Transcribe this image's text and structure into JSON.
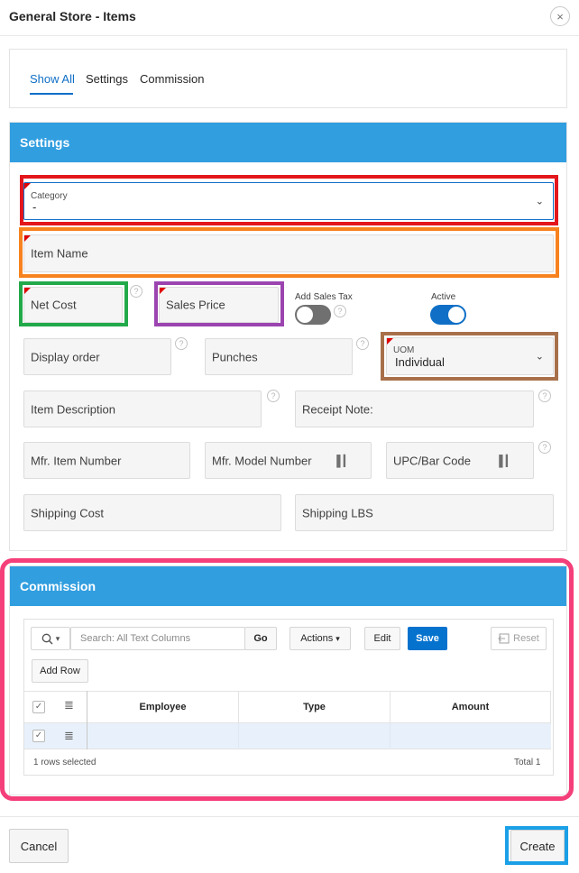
{
  "dialog": {
    "title": "General Store - Items",
    "close_icon": "×"
  },
  "tabs": [
    {
      "label": "Show All",
      "active": true
    },
    {
      "label": "Settings",
      "active": false
    },
    {
      "label": "Commission",
      "active": false
    }
  ],
  "settings": {
    "header": "Settings",
    "category": {
      "label": "Category",
      "value": "-"
    },
    "item_name": {
      "placeholder": "Item Name"
    },
    "net_cost": {
      "placeholder": "Net Cost"
    },
    "sales_price": {
      "placeholder": "Sales Price"
    },
    "add_sales_tax": {
      "label": "Add Sales Tax",
      "on": false
    },
    "active": {
      "label": "Active",
      "on": true
    },
    "display_order": {
      "placeholder": "Display order"
    },
    "punches": {
      "placeholder": "Punches"
    },
    "uom": {
      "label": "UOM",
      "value": "Individual"
    },
    "item_description": {
      "placeholder": "Item Description"
    },
    "receipt_note": {
      "placeholder": "Receipt Note:"
    },
    "mfr_item_number": {
      "placeholder": "Mfr. Item Number"
    },
    "mfr_model_number": {
      "placeholder": "Mfr. Model Number"
    },
    "upc_bar_code": {
      "placeholder": "UPC/Bar Code"
    },
    "shipping_cost": {
      "placeholder": "Shipping Cost"
    },
    "shipping_lbs": {
      "placeholder": "Shipping LBS"
    },
    "help_glyph": "?",
    "chevron_glyph": "⌄",
    "barcode_glyph": "▌▎"
  },
  "commission": {
    "header": "Commission",
    "toolbar": {
      "search_placeholder": "Search: All Text Columns",
      "go_label": "Go",
      "actions_label": "Actions",
      "edit_label": "Edit",
      "save_label": "Save",
      "reset_label": "Reset",
      "add_row_label": "Add Row"
    },
    "columns": [
      "Employee",
      "Type",
      "Amount"
    ],
    "rows": [
      {
        "employee": "",
        "type": "",
        "amount": "",
        "selected": true
      }
    ],
    "footer": {
      "selected_text": "1 rows selected",
      "total_text": "Total 1"
    }
  },
  "buttons": {
    "cancel": "Cancel",
    "create": "Create"
  },
  "highlight_colors": {
    "category": "#e3161c",
    "item_name": "#f7821e",
    "net_cost": "#22a94a",
    "sales_price": "#9b44b0",
    "uom": "#a8704a",
    "commission": "#f43f7a",
    "create": "#1aa0e6"
  },
  "colors": {
    "region_header": "#319ee0",
    "primary_button": "#0572ce",
    "active_tab": "#0f6fc6",
    "toggle_on": "#0f6fc6",
    "toggle_off": "#707070"
  }
}
